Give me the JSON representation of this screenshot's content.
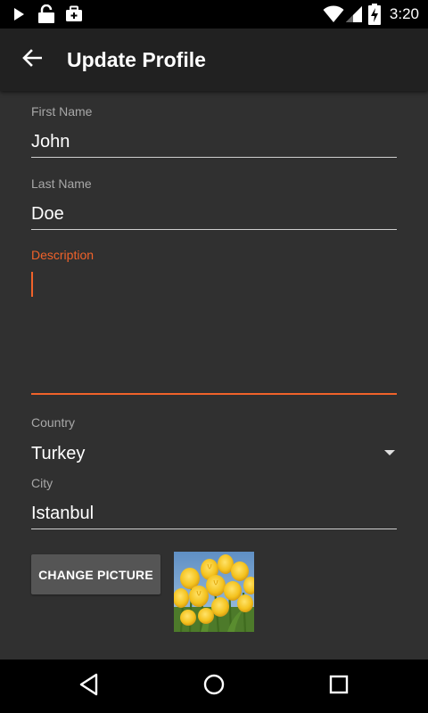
{
  "status_bar": {
    "time": "3:20",
    "icons": [
      "play-icon",
      "lock-icon",
      "briefcase-icon",
      "wifi-icon",
      "signal-icon",
      "battery-charging-icon"
    ]
  },
  "app_bar": {
    "title": "Update Profile",
    "back_icon": "arrow-back-icon"
  },
  "form": {
    "first_name": {
      "label": "First Name",
      "value": "John"
    },
    "last_name": {
      "label": "Last Name",
      "value": "Doe"
    },
    "description": {
      "label": "Description",
      "value": ""
    },
    "country": {
      "label": "Country",
      "value": "Turkey"
    },
    "city": {
      "label": "City",
      "value": "Istanbul"
    }
  },
  "picture": {
    "button_label": "CHANGE PICTURE"
  },
  "colors": {
    "accent": "#f0622a",
    "background": "#303030",
    "app_bar": "#212121",
    "button": "#555555"
  },
  "nav_bar": {
    "icons": [
      "back-triangle-icon",
      "home-circle-icon",
      "recents-square-icon"
    ]
  }
}
